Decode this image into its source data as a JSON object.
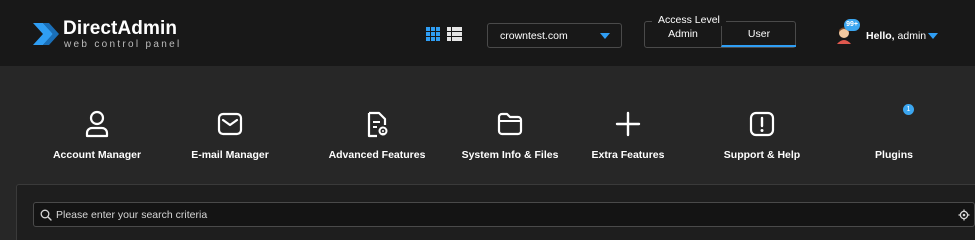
{
  "header": {
    "brand": {
      "title": "DirectAdmin",
      "subtitle": "web control panel"
    },
    "view_toggle": {
      "grid_icon": "grid-view-icon",
      "list_icon": "list-view-icon"
    },
    "domain_select": {
      "value": "crowntest.com"
    },
    "access_level": {
      "legend": "Access Level",
      "options": [
        "Admin",
        "User"
      ],
      "selected": "User"
    },
    "user": {
      "greeting": "Hello,",
      "name": "admin",
      "badge": "99+"
    }
  },
  "menu": {
    "items": [
      {
        "label": "Account Manager",
        "icon": "user-icon"
      },
      {
        "label": "E-mail Manager",
        "icon": "mail-icon"
      },
      {
        "label": "Advanced Features",
        "icon": "document-gear-icon"
      },
      {
        "label": "System Info & Files",
        "icon": "folder-icon"
      },
      {
        "label": "Extra Features",
        "icon": "plus-icon"
      },
      {
        "label": "Support & Help",
        "icon": "alert-icon"
      },
      {
        "label": "Plugins",
        "icon": "plugins-icon",
        "badge": "1"
      }
    ]
  },
  "search": {
    "placeholder": "Please enter your search criteria",
    "value": ""
  },
  "colors": {
    "accent": "#2f9ef4",
    "header_bg": "#181818",
    "body_bg": "#272727"
  }
}
